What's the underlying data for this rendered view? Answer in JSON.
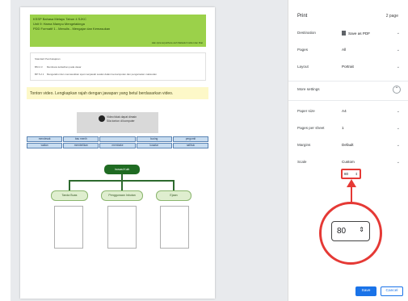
{
  "preview": {
    "header": {
      "line1": "KSSP Bahasa Melayu Tahun 4 SJKC",
      "line2": "Unit 9: Hama Mampu Mengelakinga",
      "line3": "PDD Formatif 1 - Menulis - Mengajar dan Kemasukan",
      "right_note": "Hak cipta terpelihara oleh Maliadul Institut dan lihat"
    },
    "objectives": {
      "title": "Standard Pembelajaran",
      "rows": [
        {
          "code": "BM 2.3",
          "text": "Membaca kefasihan pada dasar"
        },
        {
          "code": "BP 5.2.1",
          "text": "Mengetahui dan memasukkan ayat menjawab soalan dalam kemamputan dan pengamatan maksudan"
        }
      ]
    },
    "banner": "Tonton video. Lengkapkan rajah dengan jawapan yang betul berdasarkan video.",
    "video": {
      "line1": "Video tidak dapat dimain",
      "line2": "Sila tonton di komputer"
    },
    "words": [
      "mendesak",
      "bau menih",
      "",
      "kucing",
      "pergomit",
      "wallan",
      "membelikan",
      "membake",
      "kusatar",
      "nafihuk"
    ],
    "mindmap": {
      "center": "Inovasi Kuih",
      "branches": [
        "Tanda Buas",
        "Penggunaan Inbutan",
        "Ejaan"
      ]
    }
  },
  "panel": {
    "title": "Print",
    "page_count": "2 page",
    "destination": {
      "label": "Destination",
      "value": "Save as PDF"
    },
    "pages": {
      "label": "Pages",
      "value": "All"
    },
    "layout": {
      "label": "Layout",
      "value": "Portrait"
    },
    "more_settings": "More settings",
    "paper_size": {
      "label": "Paper size",
      "value": "A4"
    },
    "pages_per_sheet": {
      "label": "Pages per sheet",
      "value": "1"
    },
    "margins": {
      "label": "Margins",
      "value": "Default"
    },
    "scale": {
      "label": "Scale",
      "value": "Custom",
      "input": "80"
    },
    "zoom_value": "80",
    "save_label": "Save",
    "cancel_label": "Cancel"
  },
  "colors": {
    "accent": "#1a73e8",
    "highlight": "#e53935",
    "header_green": "#9bd14a"
  }
}
